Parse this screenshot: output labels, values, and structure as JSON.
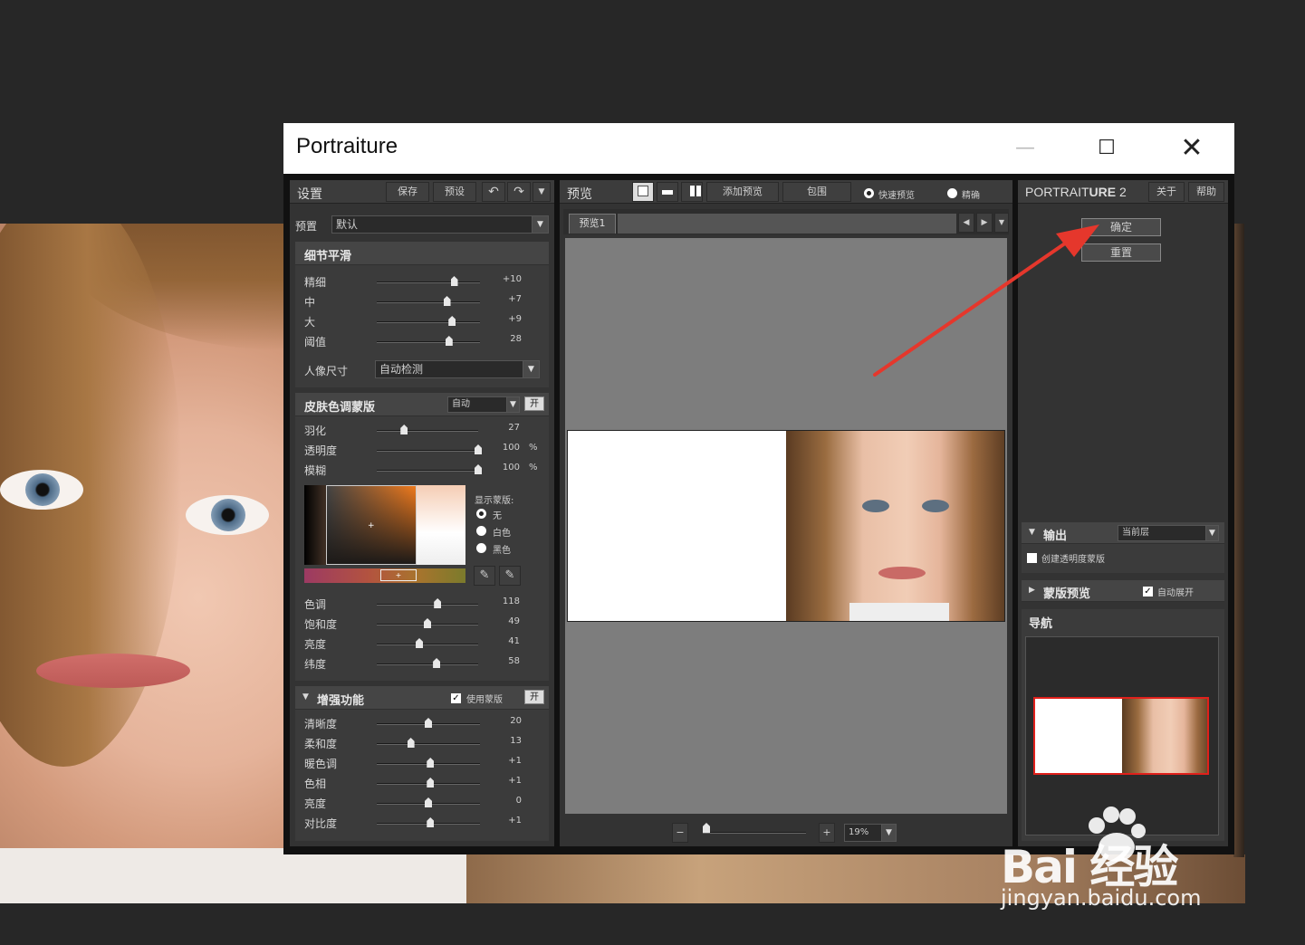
{
  "window": {
    "title": "Portraiture",
    "minimize": "—",
    "maximize": "☐",
    "close": "✕"
  },
  "settings": {
    "header": "设置",
    "save": "保存",
    "preset_btn": "预设",
    "preset_label": "预置",
    "preset_value": "默认",
    "detail": {
      "title": "细节平滑",
      "rows": [
        {
          "label": "精细",
          "value": "+10",
          "level": 0.75
        },
        {
          "label": "中",
          "value": "+7",
          "level": 0.68
        },
        {
          "label": "大",
          "value": "+9",
          "level": 0.73
        },
        {
          "label": "阈值",
          "value": "28",
          "level": 0.7
        }
      ],
      "portrait_size_label": "人像尺寸",
      "portrait_size_value": "自动检测"
    },
    "skin": {
      "title": "皮肤色调蒙版",
      "mode": "自动",
      "on": "开",
      "rows": [
        {
          "label": "羽化",
          "value": "27",
          "level": 0.27
        },
        {
          "label": "透明度",
          "value": "100",
          "level": 1.0,
          "unit": "%"
        },
        {
          "label": "模糊",
          "value": "100",
          "level": 1.0,
          "unit": "%"
        }
      ],
      "show_mask": "显示蒙版:",
      "opt_none": "无",
      "opt_white": "白色",
      "opt_black": "黑色",
      "tone_rows": [
        {
          "label": "色调",
          "value": "118",
          "level": 0.6
        },
        {
          "label": "饱和度",
          "value": "49",
          "level": 0.5
        },
        {
          "label": "亮度",
          "value": "41",
          "level": 0.42
        },
        {
          "label": "纬度",
          "value": "58",
          "level": 0.59
        }
      ]
    },
    "enhance": {
      "title": "增强功能",
      "use_mask": "使用蒙版",
      "on": "开",
      "rows": [
        {
          "label": "清晰度",
          "value": "20",
          "level": 0.5
        },
        {
          "label": "柔和度",
          "value": "13",
          "level": 0.33
        },
        {
          "label": "暖色调",
          "value": "+1",
          "level": 0.52
        },
        {
          "label": "色相",
          "value": "+1",
          "level": 0.52
        },
        {
          "label": "亮度",
          "value": "0",
          "level": 0.5
        },
        {
          "label": "对比度",
          "value": "+1",
          "level": 0.52
        }
      ]
    }
  },
  "preview": {
    "header": "预览",
    "add_preview": "添加预览",
    "wrap": "包围",
    "quick_preview": "快速预览",
    "precise": "精确",
    "tab": "预览1",
    "zoom": "19%",
    "zoom_minus": "−",
    "zoom_plus": "+"
  },
  "right": {
    "brand_a": "PORTRAIT",
    "brand_b": "URE",
    "brand_c": "2",
    "about": "关于",
    "help": "帮助",
    "ok": "确定",
    "reset": "重置",
    "output_label": "输出",
    "output_value": "当前层",
    "create_mask": "创建透明度蒙版",
    "mask_preview": "蒙版预览",
    "auto_expand": "自动展开",
    "navigation": "导航"
  },
  "watermark": {
    "main": "Bai 经验",
    "sub": "jingyan.baidu.com"
  },
  "colors": {
    "accent_red": "#e5372c",
    "panel": "#333333",
    "canvas": "#7d7d7d"
  }
}
